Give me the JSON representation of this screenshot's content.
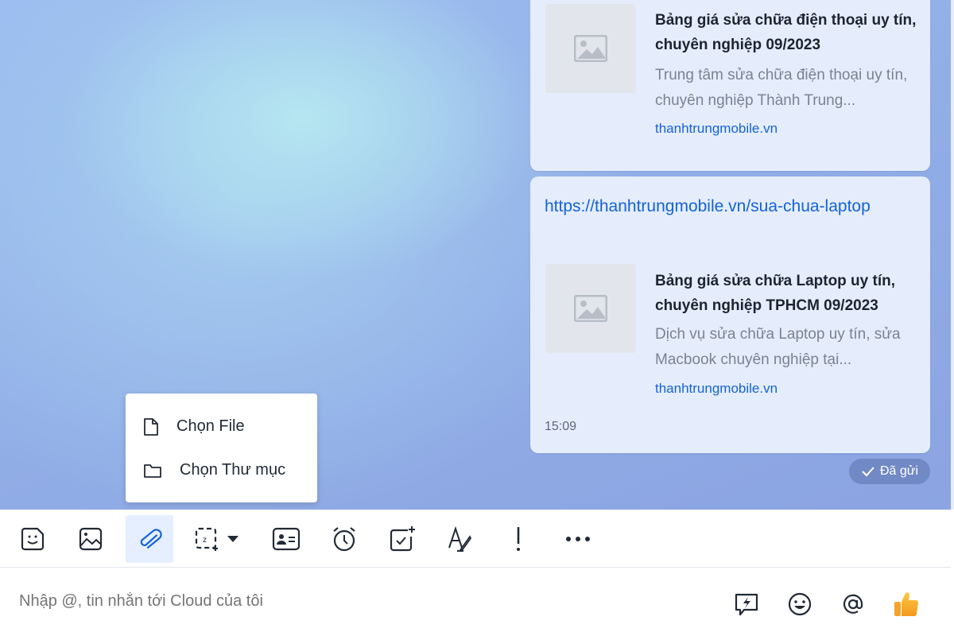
{
  "messages": [
    {
      "preview": {
        "title": "Bảng giá sửa chữa điện thoại uy tín, chuyên nghiệp 09/2023",
        "description": "Trung tâm sửa chữa điện thoại uy tín, chuyên nghiệp Thành Trung...",
        "domain": "thanhtrungmobile.vn"
      }
    },
    {
      "url": "https://thanhtrungmobile.vn/sua-chua-laptop",
      "preview": {
        "title": "Bảng giá sửa chữa Laptop uy tín, chuyên nghiệp TPHCM 09/2023",
        "description": "Dịch vụ sửa chữa Laptop uy tín, sửa Macbook chuyên nghiệp tại...",
        "domain": "thanhtrungmobile.vn"
      },
      "time": "15:09"
    }
  ],
  "status": "Đã gửi",
  "attach_menu": [
    {
      "label": "Chọn File",
      "icon": "file-icon"
    },
    {
      "label": "Chọn Thư mục",
      "icon": "folder-icon"
    }
  ],
  "toolbar": [
    "sticker",
    "image",
    "attach",
    "screenshot",
    "contact-card",
    "reminder",
    "task",
    "format-text",
    "important",
    "more"
  ],
  "input": {
    "placeholder": "Nhập @, tin nhắn tới Cloud của tôi"
  },
  "colors": {
    "accent": "#1463d6",
    "bubble": "#e5edfd",
    "thumbs_up": "#f5a623"
  }
}
